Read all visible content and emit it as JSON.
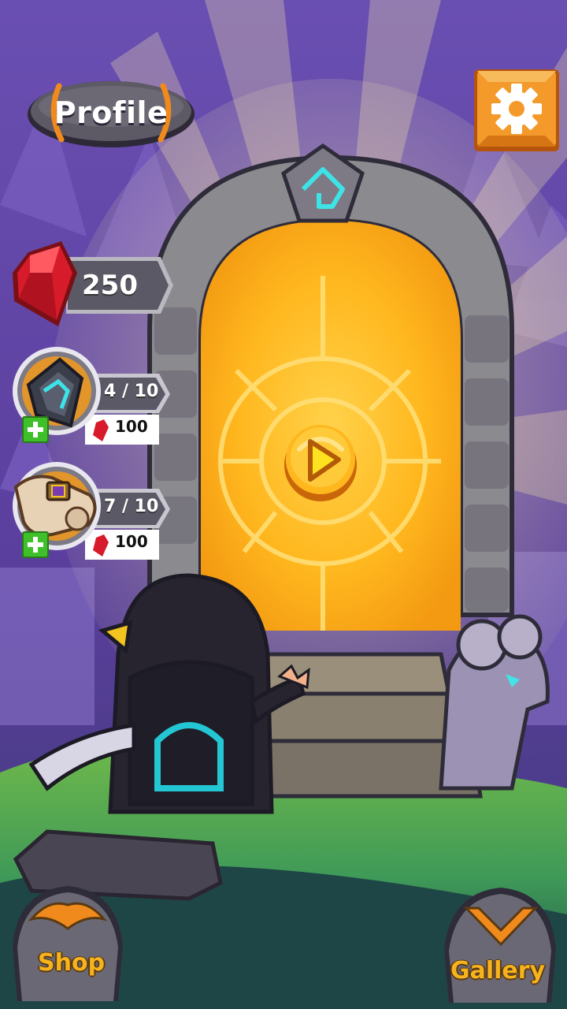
{
  "header": {
    "profile_label": "Profile"
  },
  "resources": {
    "gems": "250"
  },
  "boosters": [
    {
      "name": "crystal-booster",
      "count": "4 / 10",
      "price": "100"
    },
    {
      "name": "scroll-booster",
      "count": "7 / 10",
      "price": "100"
    }
  ],
  "nav": {
    "shop_label": "Shop",
    "gallery_label": "Gallery"
  },
  "colors": {
    "sky": "#5b3f9e",
    "portal_glow": "#ffb71e",
    "accent_orange": "#f08a1c",
    "gem_red": "#d81b2a",
    "plus_green": "#3fbf2a"
  },
  "icons": {
    "settings": "gear-icon",
    "play": "play-icon",
    "gem": "ruby-gem-icon"
  }
}
